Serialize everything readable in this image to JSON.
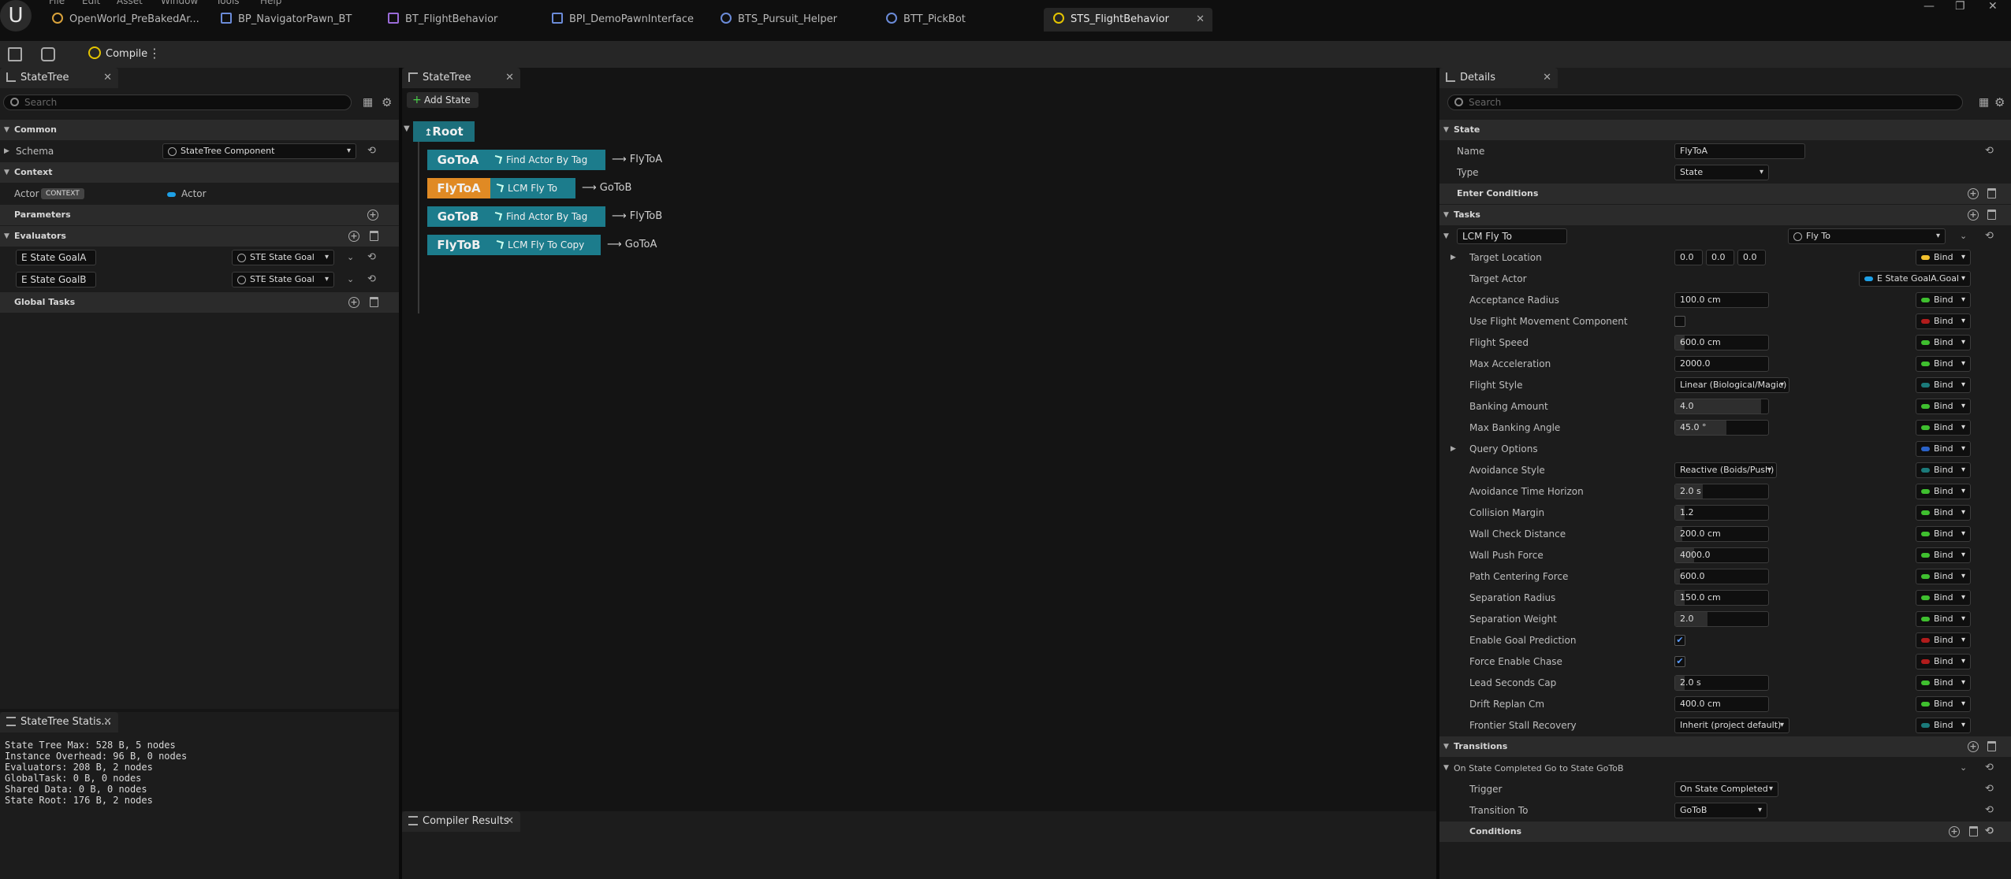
{
  "menu": [
    "File",
    "Edit",
    "Asset",
    "Window",
    "Tools",
    "Help"
  ],
  "doc_tabs": [
    {
      "label": "OpenWorld_PreBakedAr..."
    },
    {
      "label": "BP_NavigatorPawn_BT"
    },
    {
      "label": "BT_FlightBehavior"
    },
    {
      "label": "BPI_DemoPawnInterface"
    },
    {
      "label": "BTS_Pursuit_Helper"
    },
    {
      "label": "BTT_PickBot"
    },
    {
      "label": "STS_FlightBehavior"
    }
  ],
  "toolbar": {
    "compile_label": "Compile"
  },
  "left_panel": {
    "tab_label": "StateTree",
    "search_placeholder": "Search",
    "common_label": "Common",
    "schema_label": "Schema",
    "schema_value": "StateTree Component",
    "context_label": "Context",
    "actor_label": "Actor",
    "actor_badge": "CONTEXT",
    "actor_value": "Actor",
    "parameters_label": "Parameters",
    "evaluators_label": "Evaluators",
    "evaluators": [
      {
        "name": "E State GoalA",
        "type": "STE State Goal"
      },
      {
        "name": "E State GoalB",
        "type": "STE State Goal"
      }
    ],
    "global_tasks_label": "Global Tasks"
  },
  "stats_panel": {
    "tab_label": "StateTree Statis...",
    "lines": [
      "State Tree Max: 528 B, 5 nodes",
      "Instance Overhead: 96 B, 0 nodes",
      "Evaluators: 208 B, 2 nodes",
      "GlobalTask: 0 B, 0 nodes",
      "Shared Data: 0 B, 0 nodes",
      "State Root: 176 B, 2 nodes"
    ]
  },
  "center_panel": {
    "tab_label": "StateTree",
    "add_state_label": "Add State",
    "root_label": "Root",
    "states": [
      {
        "name": "GoToA",
        "task": "Find Actor By Tag",
        "transition": "FlyToA",
        "color": "#1c7c8c"
      },
      {
        "name": "FlyToA",
        "task": "LCM Fly To",
        "transition": "GoToB",
        "color": "#e08a24"
      },
      {
        "name": "GoToB",
        "task": "Find Actor By Tag",
        "transition": "FlyToB",
        "color": "#1c7c8c"
      },
      {
        "name": "FlyToB",
        "task": "LCM Fly To Copy",
        "transition": "GoToA",
        "color": "#1c7c8c"
      }
    ]
  },
  "compiler_panel": {
    "tab_label": "Compiler Results"
  },
  "details": {
    "tab_label": "Details",
    "search_placeholder": "Search",
    "state_section": "State",
    "name_label": "Name",
    "name_value": "FlyToA",
    "type_label": "Type",
    "type_value": "State",
    "enter_conditions_label": "Enter Conditions",
    "tasks_section": "Tasks",
    "task_name": "LCM Fly To",
    "task_type": "Fly To",
    "bind_label": "Bind",
    "target_location_label": "Target Location",
    "target_location": [
      "0.0",
      "0.0",
      "0.0"
    ],
    "target_actor_label": "Target Actor",
    "target_actor_value": "E State GoalA.Goal",
    "properties": [
      {
        "label": "Acceptance Radius",
        "kind": "field",
        "value": "100.0 cm",
        "fill": 0.0,
        "bind": "#3fbf2f"
      },
      {
        "label": "Use Flight Movement Component",
        "kind": "check",
        "checked": false,
        "bind": "#b11c1c"
      },
      {
        "label": "Flight Speed",
        "kind": "field",
        "value": "600.0 cm",
        "fill": 0.1,
        "bind": "#3fbf2f"
      },
      {
        "label": "Max Acceleration",
        "kind": "field",
        "value": "2000.0",
        "fill": 0.0,
        "bind": "#3fbf2f"
      },
      {
        "label": "Flight Style",
        "kind": "drop",
        "value": "Linear (Biological/Magic)",
        "bind": "#1b7a7a"
      },
      {
        "label": "Banking Amount",
        "kind": "field",
        "value": "4.0",
        "fill": 0.92,
        "bind": "#3fbf2f"
      },
      {
        "label": "Max Banking Angle",
        "kind": "field",
        "value": "45.0 °",
        "fill": 0.55,
        "bind": "#3fbf2f"
      },
      {
        "label": "Query Options",
        "kind": "expander",
        "bind": "#2a62c8"
      },
      {
        "label": "Avoidance Style",
        "kind": "drop",
        "value": "Reactive (Boids/Push)",
        "bind": "#1b7a7a"
      },
      {
        "label": "Avoidance Time Horizon",
        "kind": "field",
        "value": "2.0 s",
        "fill": 0.3,
        "bind": "#3fbf2f"
      },
      {
        "label": "Collision Margin",
        "kind": "field",
        "value": "1.2",
        "fill": 0.1,
        "bind": "#3fbf2f"
      },
      {
        "label": "Wall Check Distance",
        "kind": "field",
        "value": "200.0 cm",
        "fill": 0.08,
        "bind": "#3fbf2f"
      },
      {
        "label": "Wall Push Force",
        "kind": "field",
        "value": "4000.0",
        "fill": 0.2,
        "bind": "#3fbf2f"
      },
      {
        "label": "Path Centering Force",
        "kind": "field",
        "value": "600.0",
        "fill": 0.05,
        "bind": "#3fbf2f"
      },
      {
        "label": "Separation Radius",
        "kind": "field",
        "value": "150.0 cm",
        "fill": 0.1,
        "bind": "#3fbf2f"
      },
      {
        "label": "Separation Weight",
        "kind": "field",
        "value": "2.0",
        "fill": 0.35,
        "bind": "#3fbf2f"
      },
      {
        "label": "Enable Goal Prediction",
        "kind": "check",
        "checked": true,
        "bind": "#b11c1c"
      },
      {
        "label": "Force Enable Chase",
        "kind": "check",
        "checked": true,
        "bind": "#b11c1c"
      },
      {
        "label": "Lead Seconds Cap",
        "kind": "field",
        "value": "2.0 s",
        "fill": 0.1,
        "bind": "#3fbf2f"
      },
      {
        "label": "Drift Replan Cm",
        "kind": "field",
        "value": "400.0 cm",
        "fill": 0.0,
        "bind": "#3fbf2f"
      },
      {
        "label": "Frontier Stall Recovery",
        "kind": "drop",
        "value": "Inherit (project default)",
        "bind": "#1b7a7a"
      }
    ],
    "transitions_section": "Transitions",
    "transition_header": "On State Completed Go to State GoToB",
    "trigger_label": "Trigger",
    "trigger_value": "On State Completed",
    "transition_to_label": "Transition To",
    "transition_to_value": "GoToB",
    "conditions_label": "Conditions"
  },
  "colors": {
    "accent_teal": "#1c7c8c",
    "accent_orange": "#e08a24",
    "root": "#1c6f7c"
  }
}
